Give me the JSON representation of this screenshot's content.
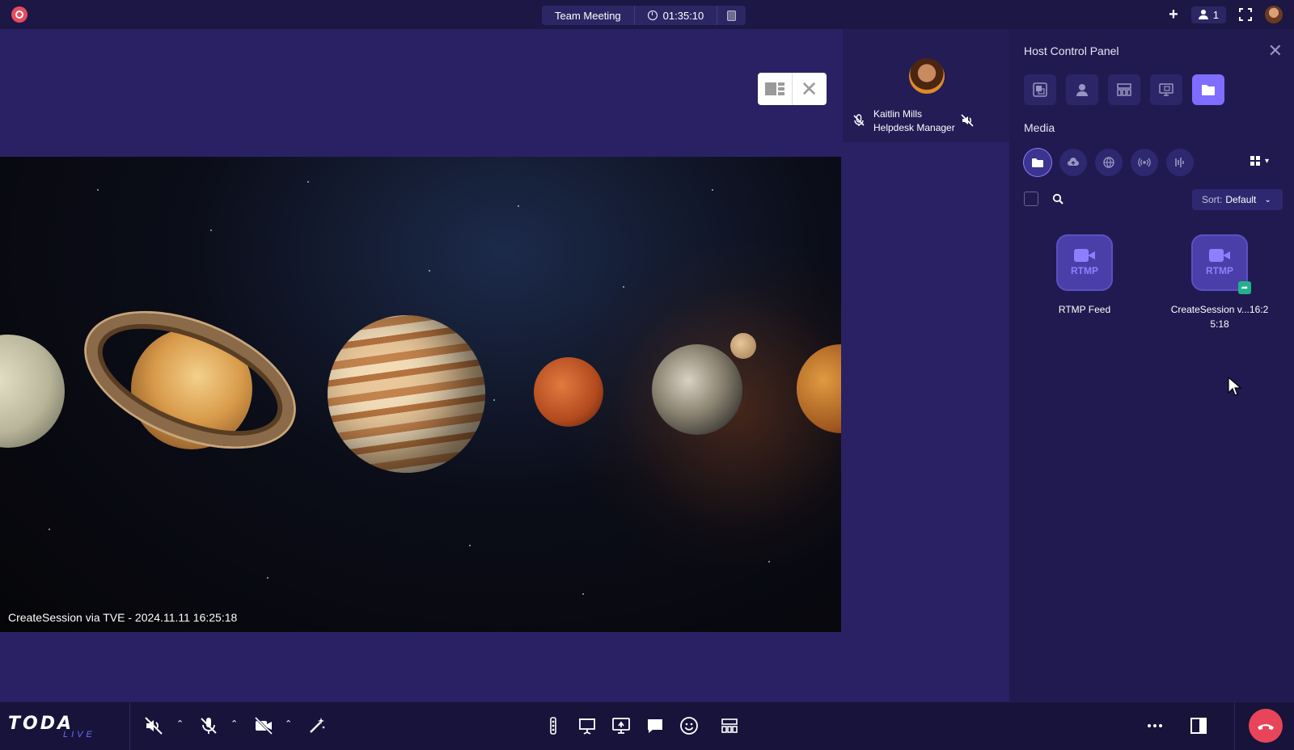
{
  "topbar": {
    "meeting_title": "Team Meeting",
    "elapsed_time": "01:35:10",
    "participant_count": "1",
    "icons": [
      "record-icon",
      "clock-icon",
      "copy-icon",
      "plus-icon",
      "people-icon",
      "fullscreen-icon",
      "user-avatar"
    ]
  },
  "stage": {
    "caption": "CreateSession via TVE - 2024.11.11 16:25:18",
    "tools": [
      "layout-icon",
      "close-icon"
    ]
  },
  "speaker": {
    "name": "Kaitlin Mills",
    "role": "Helpdesk Manager",
    "icons": [
      "mic-off-icon",
      "speaker-off-icon"
    ]
  },
  "host_panel": {
    "title": "Host Control Panel",
    "tabs": [
      "layout-tab",
      "participants-tab",
      "grid-tab",
      "screen-tab",
      "media-tab"
    ],
    "active_tab": "media-tab",
    "media_label": "Media",
    "sources": [
      "folder-source",
      "cloud-source",
      "web-source",
      "broadcast-source",
      "audio-source"
    ],
    "active_source": "folder-source",
    "sort_prefix": "Sort:",
    "sort_value": "Default",
    "items": [
      {
        "thumb_label": "RTMP",
        "name": "RTMP Feed",
        "shared": false
      },
      {
        "thumb_label": "RTMP",
        "name": "CreateSession v...16:2",
        "name_line2": "5:18",
        "shared": true
      }
    ]
  },
  "bottombar": {
    "logo_main": "TODA",
    "logo_sub": "LIVE",
    "controls_left": [
      "speaker-mute-icon",
      "mic-mute-icon",
      "camera-off-icon",
      "effects-icon"
    ],
    "controls_center": [
      "vertical-dots-icon",
      "whiteboard-icon",
      "screen-share-icon",
      "chat-icon",
      "reactions-icon",
      "layout-grid-icon"
    ],
    "controls_right": [
      "more-icon",
      "panel-toggle-icon",
      "end-call-icon"
    ],
    "colors": {
      "end_call": "#e8455a",
      "accent": "#7f6dff",
      "panel_bg": "#211a50"
    }
  }
}
